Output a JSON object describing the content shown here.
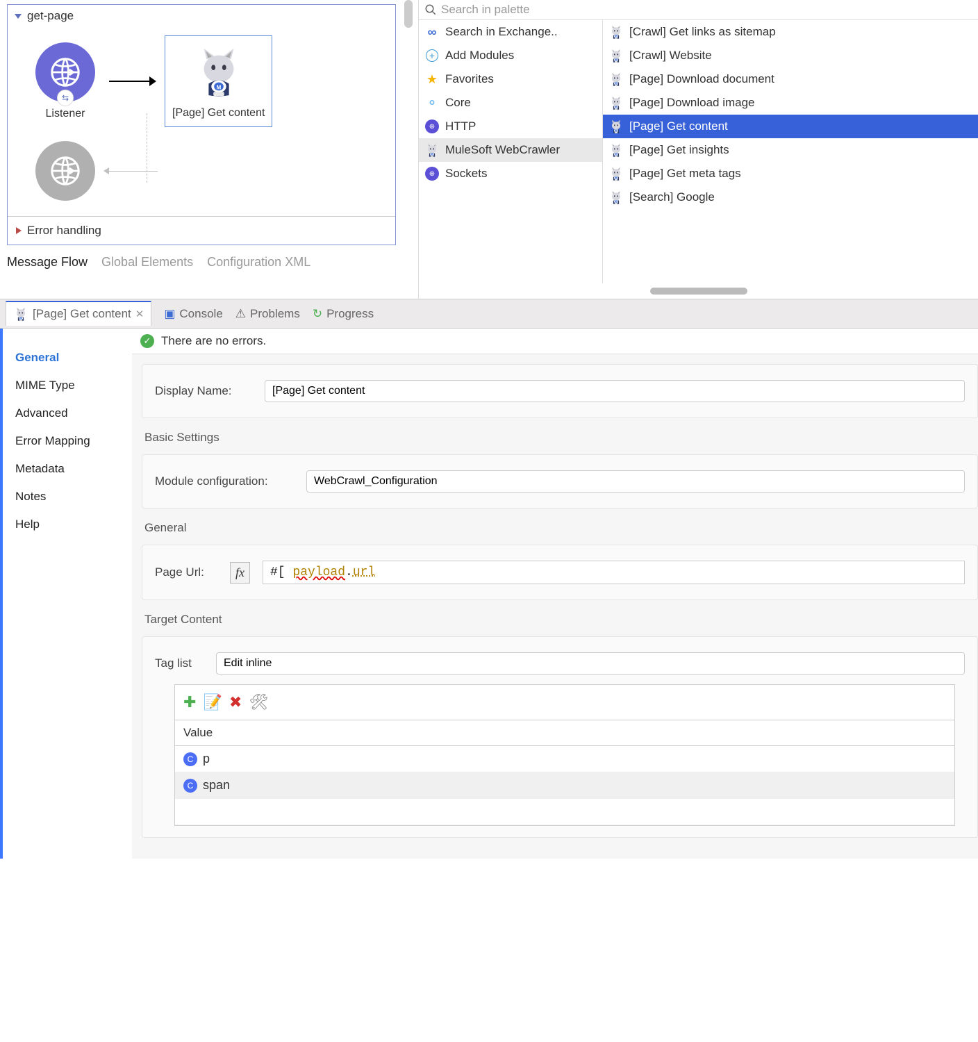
{
  "flow": {
    "name": "get-page",
    "listener_label": "Listener",
    "get_content_label": "[Page] Get content",
    "error_label": "Error handling"
  },
  "editor_tabs": [
    "Message Flow",
    "Global Elements",
    "Configuration XML"
  ],
  "palette": {
    "search_placeholder": "Search in palette",
    "left": [
      {
        "label": "Search in Exchange..",
        "icon": "exchange"
      },
      {
        "label": "Add Modules",
        "icon": "plus"
      },
      {
        "label": "Favorites",
        "icon": "star"
      },
      {
        "label": "Core",
        "icon": "core"
      },
      {
        "label": "HTTP",
        "icon": "http"
      },
      {
        "label": "MuleSoft WebCrawler",
        "icon": "cat",
        "selected": true
      },
      {
        "label": "Sockets",
        "icon": "http"
      }
    ],
    "right": [
      {
        "label": "[Crawl] Get links as sitemap"
      },
      {
        "label": "[Crawl] Website"
      },
      {
        "label": "[Page] Download document"
      },
      {
        "label": "[Page] Download image"
      },
      {
        "label": "[Page] Get content",
        "selected": true
      },
      {
        "label": "[Page] Get insights"
      },
      {
        "label": "[Page] Get meta tags"
      },
      {
        "label": "[Search] Google"
      }
    ]
  },
  "bottom_tabs": {
    "config_tab": "[Page] Get content",
    "others": [
      "Console",
      "Problems",
      "Progress"
    ]
  },
  "config_nav": [
    "General",
    "MIME Type",
    "Advanced",
    "Error Mapping",
    "Metadata",
    "Notes",
    "Help"
  ],
  "status_message": "There are no errors.",
  "form": {
    "display_name_label": "Display Name:",
    "display_name_value": "[Page] Get content",
    "basic_heading": "Basic Settings",
    "module_config_label": "Module configuration:",
    "module_config_value": "WebCrawl_Configuration",
    "general_heading": "General",
    "page_url_label": "Page Url:",
    "page_url_prefix": "#[",
    "page_url_obj": "payload",
    "page_url_dot": ".",
    "page_url_prop": "url",
    "target_heading": "Target Content",
    "tag_list_label": "Tag list",
    "tag_list_mode": "Edit inline",
    "value_header": "Value",
    "tag_values": [
      "p",
      "span"
    ]
  }
}
